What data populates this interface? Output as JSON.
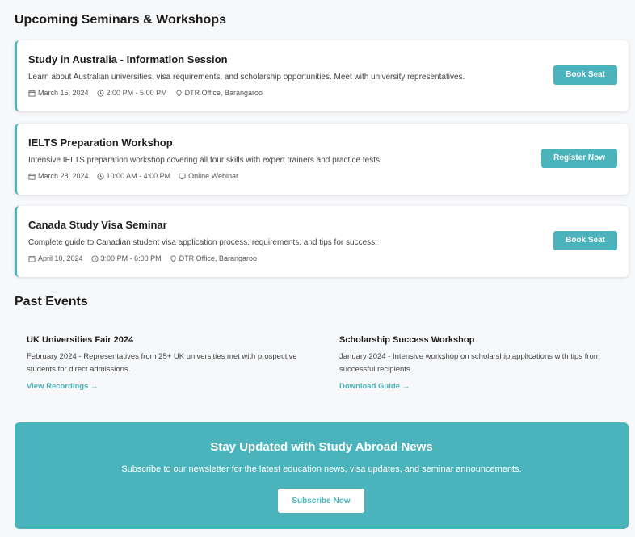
{
  "upcoming": {
    "title": "Upcoming Seminars & Workshops",
    "events": [
      {
        "title": "Study in Australia - Information Session",
        "description": "Learn about Australian universities, visa requirements, and scholarship opportunities. Meet with university representatives.",
        "date": "March 15, 2024",
        "time": "2:00 PM - 5:00 PM",
        "location": "DTR Office, Barangaroo",
        "location_icon": "map-pin-icon",
        "button": "Book Seat"
      },
      {
        "title": "IELTS Preparation Workshop",
        "description": "Intensive IELTS preparation workshop covering all four skills with expert trainers and practice tests.",
        "date": "March 28, 2024",
        "time": "10:00 AM - 4:00 PM",
        "location": "Online Webinar",
        "location_icon": "monitor-icon",
        "button": "Register Now"
      },
      {
        "title": "Canada Study Visa Seminar",
        "description": "Complete guide to Canadian student visa application process, requirements, and tips for success.",
        "date": "April 10, 2024",
        "time": "3:00 PM - 6:00 PM",
        "location": "DTR Office, Barangaroo",
        "location_icon": "map-pin-icon",
        "button": "Book Seat"
      }
    ]
  },
  "past": {
    "title": "Past Events",
    "items": [
      {
        "title": "UK Universities Fair 2024",
        "description": "February 2024 - Representatives from 25+ UK universities met with prospective students for direct admissions.",
        "link": "View Recordings →"
      },
      {
        "title": "Scholarship Success Workshop",
        "description": "January 2024 - Intensive workshop on scholarship applications with tips from successful recipients.",
        "link": "Download Guide →"
      }
    ]
  },
  "newsletter": {
    "title": "Stay Updated with Study Abroad News",
    "description": "Subscribe to our newsletter for the latest education news, visa updates, and seminar announcements.",
    "button": "Subscribe Now"
  },
  "colors": {
    "accent": "#4ab3bb",
    "background": "#f7f8fa",
    "card": "#ffffff"
  }
}
